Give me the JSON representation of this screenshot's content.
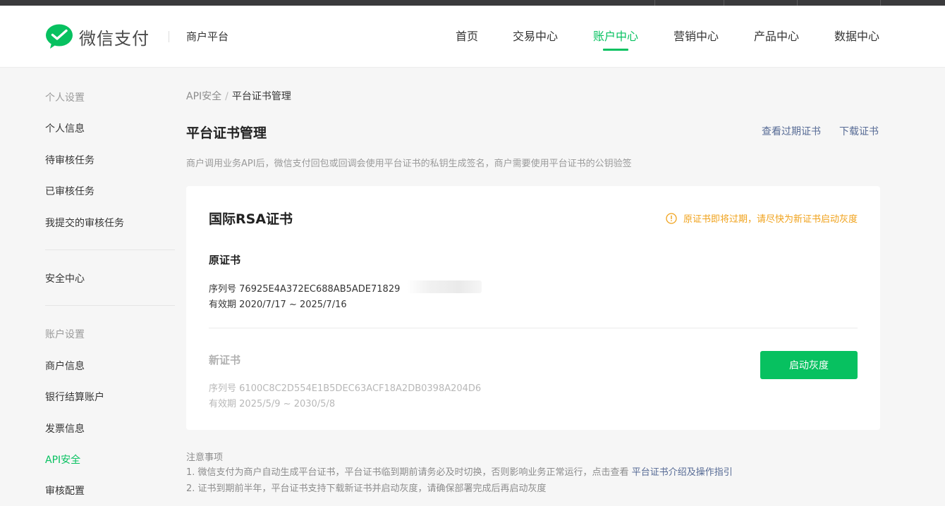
{
  "brand": {
    "logo_text": "微信支付",
    "platform": "商户平台",
    "accent": "#07c160",
    "link_color": "#576b95",
    "warning_color": "#f0a21b"
  },
  "nav": {
    "items": [
      {
        "label": "首页",
        "active": false
      },
      {
        "label": "交易中心",
        "active": false
      },
      {
        "label": "账户中心",
        "active": true
      },
      {
        "label": "营销中心",
        "active": false
      },
      {
        "label": "产品中心",
        "active": false
      },
      {
        "label": "数据中心",
        "active": false
      }
    ]
  },
  "sidebar": {
    "group_personal": "个人设置",
    "personal_items": [
      {
        "label": "个人信息"
      },
      {
        "label": "待审核任务"
      },
      {
        "label": "已审核任务"
      },
      {
        "label": "我提交的审核任务"
      }
    ],
    "security_center": "安全中心",
    "group_account": "账户设置",
    "account_items": [
      {
        "label": "商户信息",
        "active": false
      },
      {
        "label": "银行结算账户",
        "active": false
      },
      {
        "label": "发票信息",
        "active": false
      },
      {
        "label": "API安全",
        "active": true
      },
      {
        "label": "审核配置",
        "active": false
      }
    ]
  },
  "breadcrumb": {
    "parent": "API安全",
    "separator": "/",
    "current": "平台证书管理"
  },
  "page": {
    "title": "平台证书管理",
    "link_expired": "查看过期证书",
    "link_download": "下载证书",
    "description": "商户调用业务API后，微信支付回包或回调会使用平台证书的私钥生成签名，商户需要使用平台证书的公钥验签"
  },
  "card": {
    "title": "国际RSA证书",
    "warning": "原证书即将过期，请尽快为新证书启动灰度",
    "warning_icon": "info-circle-icon",
    "original": {
      "title": "原证书",
      "serial_label": "序列号",
      "serial": "76925E4A372EC688AB5ADE71829",
      "validity_label": "有效期",
      "validity": "2020/7/17 ~ 2025/7/16"
    },
    "new": {
      "title": "新证书",
      "serial_label": "序列号",
      "serial": "6100C8C2D554E1B5DEC63ACF18A2DB0398A204D6",
      "validity_label": "有效期",
      "validity": "2025/5/9 ~ 2030/5/8"
    },
    "button_label": "启动灰度"
  },
  "notes": {
    "title": "注意事项",
    "item1_text": "1. 微信支付为商户自动生成平台证书，平台证书临到期前请务必及时切换，否则影响业务正常运行，点击查看",
    "item1_link": "平台证书介绍及操作指引",
    "item2_text": "2. 证书到期前半年，平台证书支持下载新证书并启动灰度，请确保部署完成后再启动灰度"
  }
}
